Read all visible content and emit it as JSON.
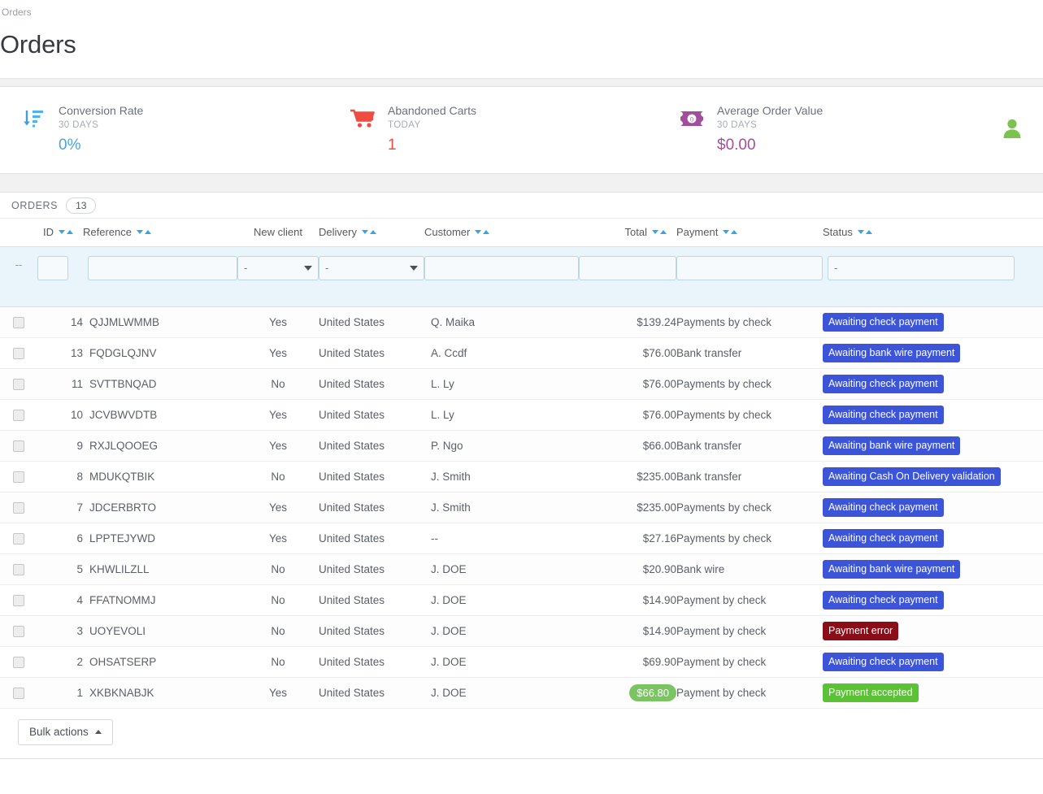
{
  "header": {
    "breadcrumb": "Orders",
    "title": "Orders"
  },
  "kpis": [
    {
      "icon": "sort-descending-icon",
      "label": "Conversion Rate",
      "period": "30 DAYS",
      "value": "0%",
      "color": "#4ba3dd"
    },
    {
      "icon": "shopping-cart-icon",
      "label": "Abandoned Carts",
      "period": "TODAY",
      "value": "1",
      "color": "#ef4c42"
    },
    {
      "icon": "banknote-icon",
      "label": "Average Order Value",
      "period": "30 DAYS",
      "value": "$0.00",
      "color": "#a14f9a"
    },
    {
      "icon": "person-icon",
      "label": "",
      "period": "",
      "value": "",
      "color": "#7cc24f"
    }
  ],
  "panel": {
    "section_label": "ORDERS",
    "count": "13"
  },
  "table": {
    "headers": {
      "id": "ID",
      "reference": "Reference",
      "new_client": "New client",
      "delivery": "Delivery",
      "customer": "Customer",
      "total": "Total",
      "payment": "Payment",
      "status": "Status"
    },
    "filters": {
      "select_all_dash": "--",
      "id_value": "",
      "reference_value": "",
      "new_client_value": "-",
      "delivery_value": "-",
      "customer_value": "",
      "total_value": "",
      "payment_value": "",
      "status_value": "-"
    },
    "rows": [
      {
        "id": "14",
        "reference": "QJJMLWMMB",
        "new_client": "Yes",
        "delivery": "United States",
        "customer": "Q. Maika",
        "total": "$139.24",
        "total_highlight": false,
        "payment": "Payments by check",
        "status": "Awaiting check payment",
        "status_style": "blue"
      },
      {
        "id": "13",
        "reference": "FQDGLQJNV",
        "new_client": "Yes",
        "delivery": "United States",
        "customer": "A. Ccdf",
        "total": "$76.00",
        "total_highlight": false,
        "payment": "Bank transfer",
        "status": "Awaiting bank wire payment",
        "status_style": "blue"
      },
      {
        "id": "11",
        "reference": "SVTTBNQAD",
        "new_client": "No",
        "delivery": "United States",
        "customer": "L. Ly",
        "total": "$76.00",
        "total_highlight": false,
        "payment": "Payments by check",
        "status": "Awaiting check payment",
        "status_style": "blue"
      },
      {
        "id": "10",
        "reference": "JCVBWVDTB",
        "new_client": "Yes",
        "delivery": "United States",
        "customer": "L. Ly",
        "total": "$76.00",
        "total_highlight": false,
        "payment": "Payments by check",
        "status": "Awaiting check payment",
        "status_style": "blue"
      },
      {
        "id": "9",
        "reference": "RXJLQOOEG",
        "new_client": "Yes",
        "delivery": "United States",
        "customer": "P. Ngo",
        "total": "$66.00",
        "total_highlight": false,
        "payment": "Bank transfer",
        "status": "Awaiting bank wire payment",
        "status_style": "blue"
      },
      {
        "id": "8",
        "reference": "MDUKQTBIK",
        "new_client": "No",
        "delivery": "United States",
        "customer": "J. Smith",
        "total": "$235.00",
        "total_highlight": false,
        "payment": "Bank transfer",
        "status": "Awaiting Cash On Delivery validation",
        "status_style": "blue"
      },
      {
        "id": "7",
        "reference": "JDCERBRTO",
        "new_client": "Yes",
        "delivery": "United States",
        "customer": "J. Smith",
        "total": "$235.00",
        "total_highlight": false,
        "payment": "Payments by check",
        "status": "Awaiting check payment",
        "status_style": "blue"
      },
      {
        "id": "6",
        "reference": "LPPTEJYWD",
        "new_client": "Yes",
        "delivery": "United States",
        "customer": "--",
        "total": "$27.16",
        "total_highlight": false,
        "payment": "Payments by check",
        "status": "Awaiting check payment",
        "status_style": "blue"
      },
      {
        "id": "5",
        "reference": "KHWLILZLL",
        "new_client": "No",
        "delivery": "United States",
        "customer": "J. DOE",
        "total": "$20.90",
        "total_highlight": false,
        "payment": "Bank wire",
        "status": "Awaiting bank wire payment",
        "status_style": "blue"
      },
      {
        "id": "4",
        "reference": "FFATNOMMJ",
        "new_client": "No",
        "delivery": "United States",
        "customer": "J. DOE",
        "total": "$14.90",
        "total_highlight": false,
        "payment": "Payment by check",
        "status": "Awaiting check payment",
        "status_style": "blue"
      },
      {
        "id": "3",
        "reference": "UOYEVOLI",
        "new_client": "No",
        "delivery": "United States",
        "customer": "J. DOE",
        "total": "$14.90",
        "total_highlight": false,
        "payment": "Payment by check",
        "status": "Payment error",
        "status_style": "red"
      },
      {
        "id": "2",
        "reference": "OHSATSERP",
        "new_client": "No",
        "delivery": "United States",
        "customer": "J. DOE",
        "total": "$69.90",
        "total_highlight": false,
        "payment": "Payment by check",
        "status": "Awaiting check payment",
        "status_style": "blue"
      },
      {
        "id": "1",
        "reference": "XKBKNABJK",
        "new_client": "Yes",
        "delivery": "United States",
        "customer": "J. DOE",
        "total": "$66.80",
        "total_highlight": true,
        "payment": "Payment by check",
        "status": "Payment accepted",
        "status_style": "green"
      }
    ]
  },
  "footer": {
    "bulk_actions_label": "Bulk actions"
  },
  "colors": {
    "badge_blue": "#3c55d8",
    "badge_red": "#8b0d17",
    "badge_green": "#5bc236",
    "sort_arrow": "#38a5e0",
    "filter_row_bg": "#eaf4fb"
  }
}
